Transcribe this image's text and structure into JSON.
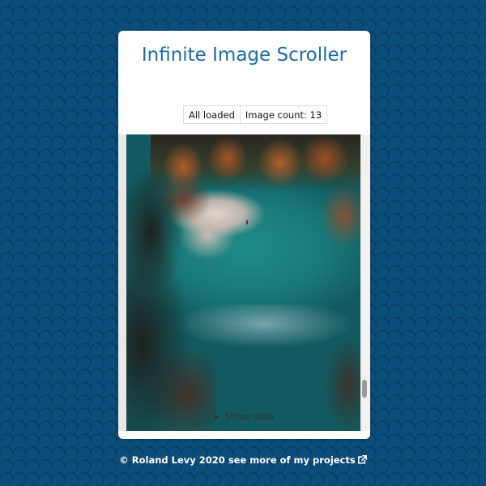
{
  "app": {
    "title": "Infinite Image Scroller"
  },
  "status": {
    "loaded_label": "All loaded",
    "image_count_label": "Image count: 13"
  },
  "gallery": {
    "scroll_position_fraction": 0.88
  },
  "details": {
    "toggle_label": "Show data"
  },
  "footer": {
    "copyright": "© Roland Levy 2020",
    "link_text": "see more of my projects",
    "link_icon": "external-link-icon"
  },
  "colors": {
    "background": "#0c4e7b",
    "title": "#1c6aa6",
    "card": "#ffffff"
  }
}
